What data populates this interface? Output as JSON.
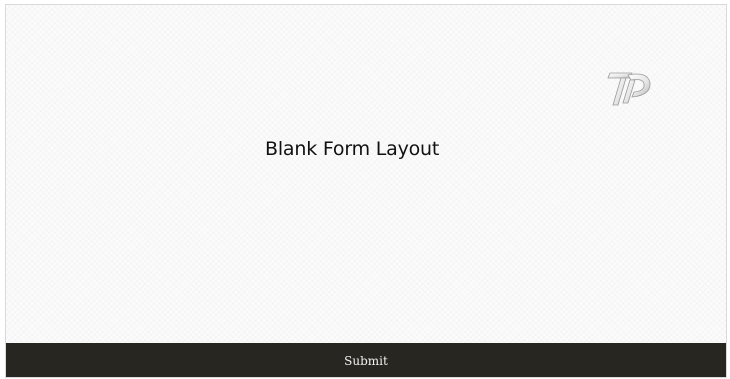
{
  "form": {
    "title": "Blank Form Layout",
    "submit_label": "Submit"
  },
  "logo": {
    "icon": "tp-logo-icon",
    "alt_text": "TP"
  },
  "colors": {
    "background": "#fbfbfb",
    "footer_bar": "#272621",
    "submit_text": "#f2f2f2",
    "title_text": "#111111"
  }
}
